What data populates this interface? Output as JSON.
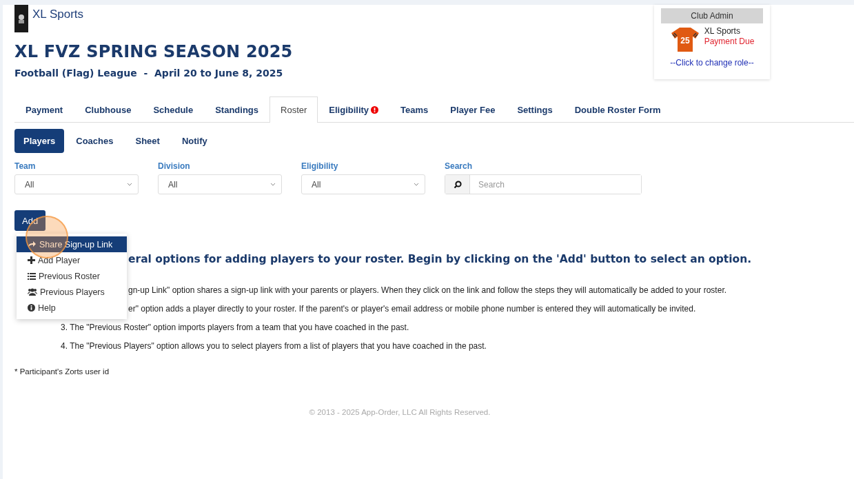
{
  "header": {
    "org": "XL Sports",
    "title": "XL FVZ SPRING SEASON 2025",
    "subtitle": "Football (Flag) League  -  April 20 to June 8, 2025"
  },
  "role_box": {
    "title": "Club Admin",
    "jersey_number": "25",
    "org": "XL Sports",
    "status": "Payment Due",
    "link": "--Click to change role--"
  },
  "tabs": [
    {
      "label": "Payment",
      "selected": false,
      "alert": false
    },
    {
      "label": "Clubhouse",
      "selected": false,
      "alert": false
    },
    {
      "label": "Schedule",
      "selected": false,
      "alert": false
    },
    {
      "label": "Standings",
      "selected": false,
      "alert": false
    },
    {
      "label": "Roster",
      "selected": true,
      "alert": false
    },
    {
      "label": "Eligibility",
      "selected": false,
      "alert": true
    },
    {
      "label": "Teams",
      "selected": false,
      "alert": false
    },
    {
      "label": "Player Fee",
      "selected": false,
      "alert": false
    },
    {
      "label": "Settings",
      "selected": false,
      "alert": false
    },
    {
      "label": "Double Roster Form",
      "selected": false,
      "alert": false
    }
  ],
  "subtabs": [
    {
      "label": "Players",
      "selected": true
    },
    {
      "label": "Coaches",
      "selected": false
    },
    {
      "label": "Sheet",
      "selected": false
    },
    {
      "label": "Notify",
      "selected": false
    }
  ],
  "filters": [
    {
      "label": "Team",
      "value": "All"
    },
    {
      "label": "Division",
      "value": "All"
    },
    {
      "label": "Eligibility",
      "value": "All"
    }
  ],
  "search": {
    "label": "Search",
    "placeholder": "Search"
  },
  "add_button": "Add",
  "add_menu": [
    {
      "label": "Share Sign-up Link",
      "selected": true
    },
    {
      "label": "Add Player",
      "selected": false
    },
    {
      "label": "Previous Roster",
      "selected": false
    },
    {
      "label": "Previous Players",
      "selected": false
    },
    {
      "label": "Help",
      "selected": false
    }
  ],
  "heading": "eral options for adding players to your roster. Begin by clicking on the 'Add' button to select an option.",
  "options": [
    "gn-up Link\" option shares a sign-up link with your parents or players. When they click on the link and follow the steps they will automatically be added to your roster.",
    "er\" option adds a player directly to your roster. If the parent's or player's email address or mobile phone number is entered they will automatically be invited.",
    "3. The \"Previous Roster\" option imports players from a team that you have coached in the past.",
    "4. The \"Previous Players\" option allows you to select players from a list of players that you have coached in the past."
  ],
  "footnote": "* Participant's Zorts user id",
  "copyright": "© 2013 - 2025 App-Order, LLC All Rights Reserved."
}
